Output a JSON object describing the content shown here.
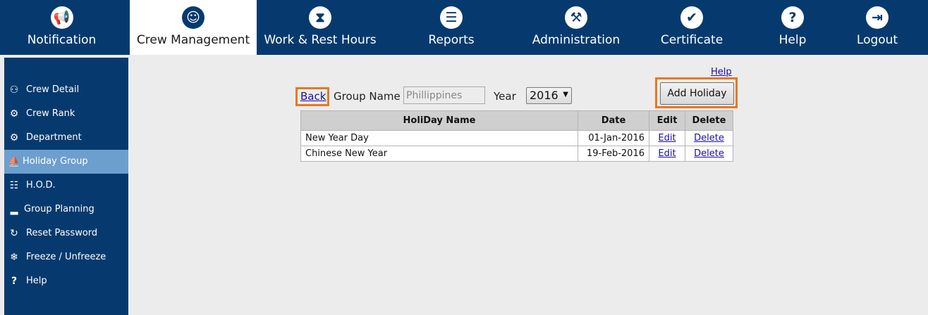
{
  "nav": {
    "items": [
      {
        "label": "Notification",
        "icon": "megaphone-icon"
      },
      {
        "label": "Crew Management",
        "icon": "crew-group-icon"
      },
      {
        "label": "Work & Rest Hours",
        "icon": "hourglass-icon"
      },
      {
        "label": "Reports",
        "icon": "reports-icon"
      },
      {
        "label": "Administration",
        "icon": "administration-icon"
      },
      {
        "label": "Certificate",
        "icon": "certificate-icon"
      },
      {
        "label": "Help",
        "icon": "question-icon"
      },
      {
        "label": "Logout",
        "icon": "logout-icon"
      }
    ],
    "active": "Crew Management"
  },
  "sidebar": {
    "items": [
      {
        "label": "Crew Detail",
        "icon": "crew-detail-icon"
      },
      {
        "label": "Crew Rank",
        "icon": "crew-rank-icon"
      },
      {
        "label": "Department",
        "icon": "department-icon"
      },
      {
        "label": "Holiday Group",
        "icon": "holiday-group-icon"
      },
      {
        "label": "H.O.D.",
        "icon": "hod-icon"
      },
      {
        "label": "Group Planning",
        "icon": "group-planning-icon"
      },
      {
        "label": "Reset Password",
        "icon": "reset-password-icon"
      },
      {
        "label": "Freeze / Unfreeze",
        "icon": "snowflake-icon"
      },
      {
        "label": "Help",
        "icon": "question-icon"
      }
    ],
    "active": "Holiday Group"
  },
  "content": {
    "help_link": "Help",
    "back_link": "Back",
    "group_name_label": "Group Name",
    "group_name_value": "Phillippines",
    "year_label": "Year",
    "year_value": "2016",
    "add_button": "Add Holiday"
  },
  "table": {
    "headers": [
      "HoliDay Name",
      "Date",
      "Edit",
      "Delete"
    ],
    "rows": [
      {
        "name": "New Year Day",
        "date": "01-Jan-2016",
        "edit": "Edit",
        "delete": "Delete"
      },
      {
        "name": "Chinese New Year",
        "date": "19-Feb-2016",
        "edit": "Edit",
        "delete": "Delete"
      }
    ]
  },
  "colors": {
    "nav_bg": "#063a6e",
    "sidebar_active": "#6c9fce",
    "highlight_orange": "#e87722",
    "link": "#1a0dab"
  }
}
